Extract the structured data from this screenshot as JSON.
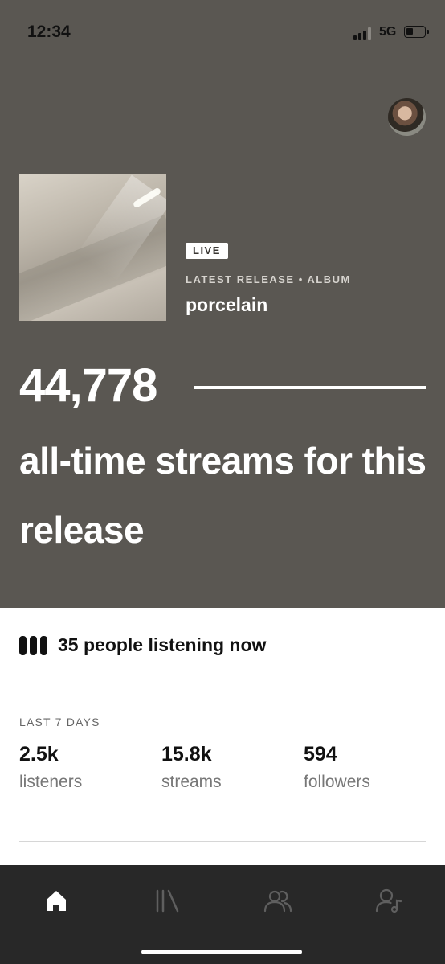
{
  "status_bar": {
    "time": "12:34",
    "network": "5G"
  },
  "release": {
    "badge": "LIVE",
    "meta": "LATEST RELEASE • ALBUM",
    "title": "porcelain",
    "streams": "44,778",
    "streams_caption": "all-time streams for this release"
  },
  "listening_now": "35 people listening now",
  "last_7_days": {
    "label": "LAST 7 DAYS",
    "stats": [
      {
        "value": "2.5k",
        "label": "listeners"
      },
      {
        "value": "15.8k",
        "label": "streams"
      },
      {
        "value": "594",
        "label": "followers"
      }
    ]
  },
  "tabs": [
    {
      "icon": "home-icon",
      "active": true
    },
    {
      "icon": "library-icon",
      "active": false
    },
    {
      "icon": "audience-icon",
      "active": false
    },
    {
      "icon": "profile-music-icon",
      "active": false
    }
  ],
  "colors": {
    "hero_bg": "#5a5752",
    "tab_bar_bg": "#282828",
    "active_tab": "#ffffff",
    "inactive_tab": "#5f5f5f"
  }
}
